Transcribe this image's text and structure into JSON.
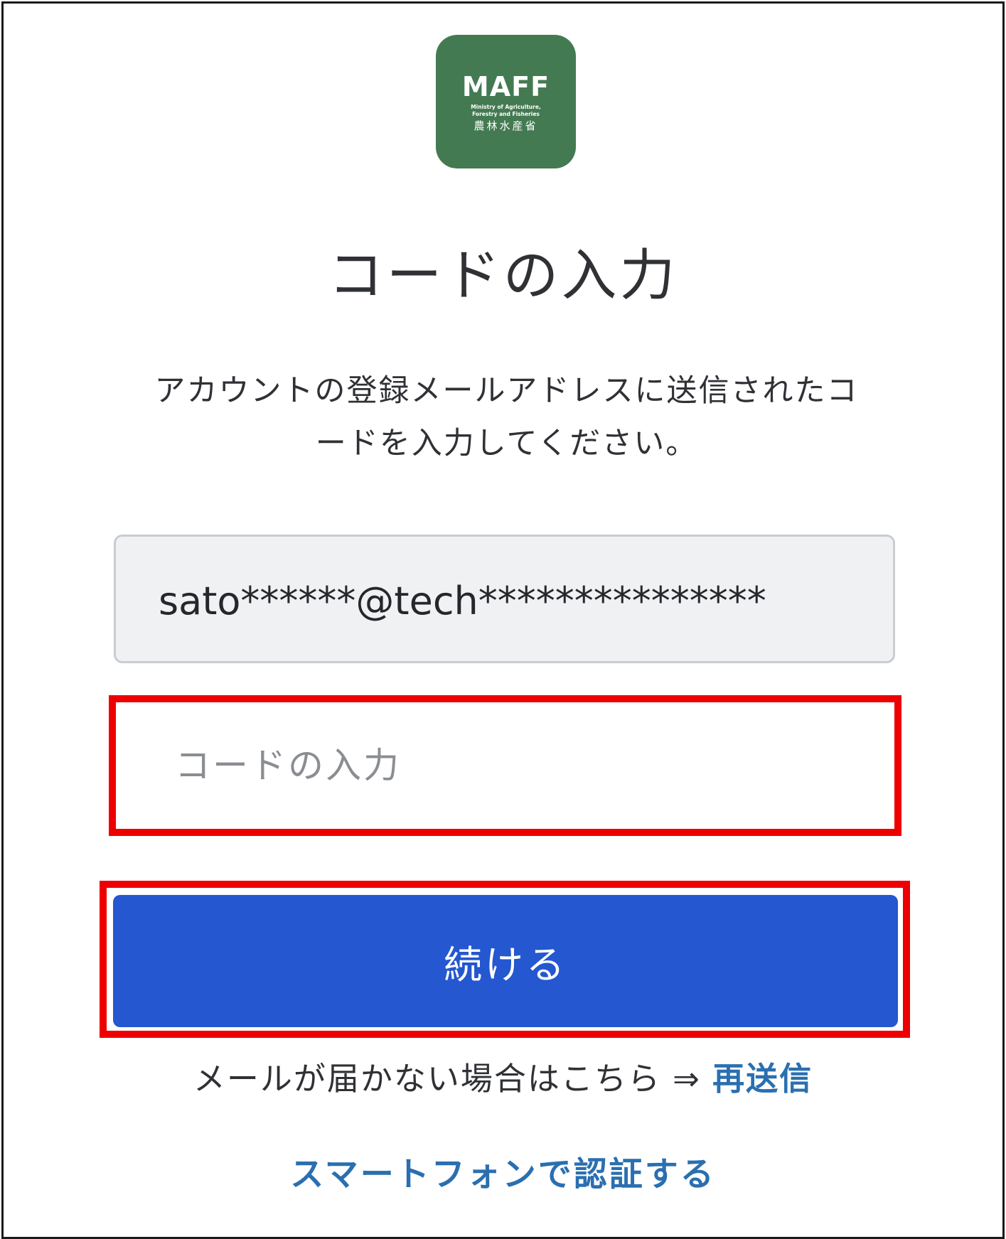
{
  "logo": {
    "wordmark": "MAFF",
    "subtitle_line1": "Ministry of Agriculture,",
    "subtitle_line2": "Forestry and Fisheries",
    "kanji": "農林水産省"
  },
  "title": "コードの入力",
  "instruction_line1": "アカウントの登録メールアドレスに送信されたコ",
  "instruction_line2": "ードを入力してください。",
  "email": {
    "value": "sato******@tech***************"
  },
  "code_input": {
    "placeholder": "コードの入力",
    "value": ""
  },
  "continue_button": {
    "label": "続ける"
  },
  "resend": {
    "text": "メールが届かない場合はこちら ⇒ ",
    "link_label": "再送信"
  },
  "smartphone_link": {
    "label": "スマートフォンで認証する"
  },
  "colors": {
    "logo_green": "#447a52",
    "button_blue": "#2457d0",
    "link_blue": "#2a6fb0",
    "highlight_red": "#ee0000"
  }
}
